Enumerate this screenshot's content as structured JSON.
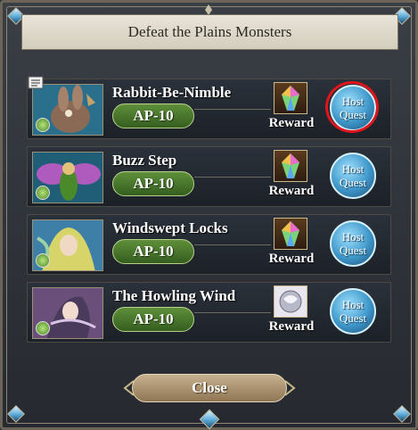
{
  "dialog": {
    "title": "Defeat the Plains Monsters",
    "close_label": "Close"
  },
  "quests": [
    {
      "name": "Rabbit-Be-Nimble",
      "ap": "AP-10",
      "reward_label": "Reward",
      "reward_icon": "rainbow-crystal-icon",
      "host_label_1": "Host",
      "host_label_2": "Quest",
      "highlighted": true,
      "has_note": true
    },
    {
      "name": "Buzz Step",
      "ap": "AP-10",
      "reward_label": "Reward",
      "reward_icon": "rainbow-crystal-icon",
      "host_label_1": "Host",
      "host_label_2": "Quest",
      "highlighted": false,
      "has_note": false
    },
    {
      "name": "Windswept Locks",
      "ap": "AP-10",
      "reward_label": "Reward",
      "reward_icon": "rainbow-crystal-icon",
      "host_label_1": "Host",
      "host_label_2": "Quest",
      "highlighted": false,
      "has_note": false
    },
    {
      "name": "The Howling Wind",
      "ap": "AP-10",
      "reward_label": "Reward",
      "reward_icon": "silver-orb-icon",
      "host_label_1": "Host",
      "host_label_2": "Quest",
      "highlighted": false,
      "has_note": false
    }
  ],
  "colors": {
    "highlight_ring": "#e0141c",
    "ap_pill": "#4b7a2d",
    "host_button": "#3e97c9"
  }
}
